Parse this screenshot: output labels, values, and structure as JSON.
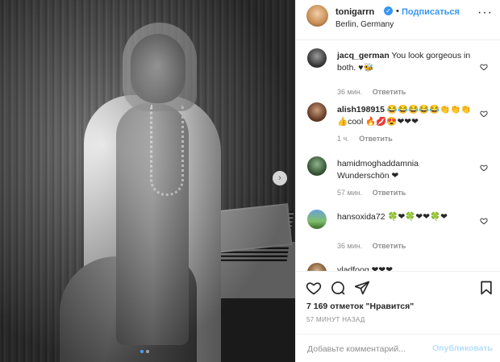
{
  "post": {
    "username": "tonigarrn",
    "verified_mark": "✓",
    "separator": "•",
    "follow_label": "Подписаться",
    "location": "Berlin, Germany",
    "more_icon": "···"
  },
  "carousel": {
    "next_icon": "›",
    "active_dot": 0,
    "dot_count": 2
  },
  "comments": [
    {
      "username": "jacq_german",
      "text": "You look gorgeous in both. ♥🐝",
      "time": "36 мин.",
      "reply": "Ответить"
    },
    {
      "username": "alish198915",
      "text": "😂😂😂😂😂👏👏👏👍cool 🔥💋😍❤❤❤",
      "time": "1 ч.",
      "reply": "Ответить"
    },
    {
      "username": "hamidmoghaddamnia",
      "text": "Wunderschön ❤",
      "time": "57 мин.",
      "reply": "Ответить"
    },
    {
      "username": "hansoxida72",
      "text": "🍀❤🍀❤❤🍀❤",
      "time": "36 мин.",
      "reply": "Ответить"
    },
    {
      "username": "vladfoog",
      "text": "❤❤❤",
      "time": "",
      "reply": ""
    }
  ],
  "likes_text": "7 169 отметок \"Нравится\"",
  "time_ago": "57 МИНУТ НАЗАД",
  "composer": {
    "placeholder": "Добавьте комментарий...",
    "publish_label": "Опубликовать"
  },
  "colors": {
    "accent": "#3897f0",
    "publish_disabled": "#b2dffc",
    "muted": "#8e8e8e"
  }
}
